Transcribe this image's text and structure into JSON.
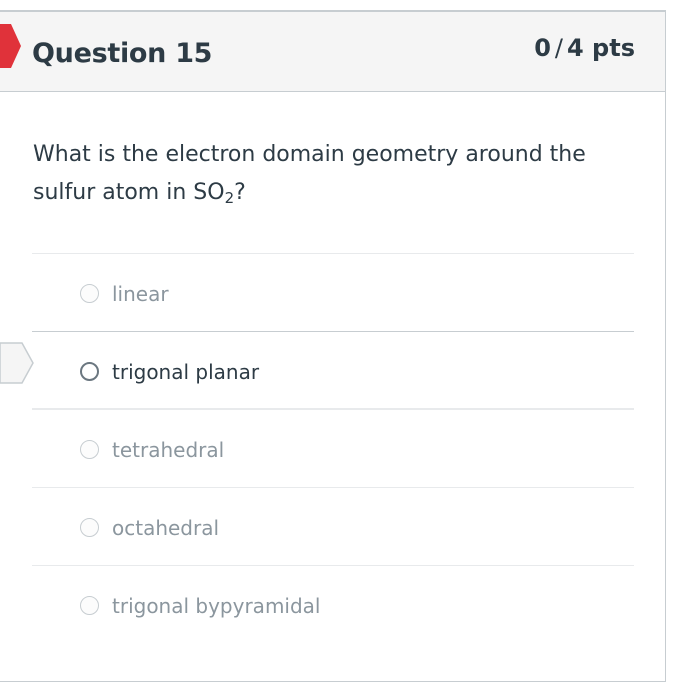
{
  "question": {
    "title": "Question 15",
    "score": "0",
    "points_label": "4 pts",
    "text_before": "What is the electron domain geometry around the sulfur atom in SO",
    "subscript": "2",
    "text_after": "?"
  },
  "answers": [
    {
      "label": "linear",
      "selected": false
    },
    {
      "label": "trigonal planar",
      "selected": true
    },
    {
      "label": "tetrahedral",
      "selected": false
    },
    {
      "label": "octahedral",
      "selected": false
    },
    {
      "label": "trigonal bypyramidal",
      "selected": false
    }
  ],
  "colors": {
    "flag": "#e0323a",
    "text": "#2d3b45",
    "muted_text": "#8b969e",
    "header_bg": "#f5f5f5",
    "border": "#c7cdd1"
  },
  "icons": {
    "incorrect_flag": "incorrect-answer-flag-icon",
    "selected_pointer": "your-answer-arrow-icon"
  }
}
